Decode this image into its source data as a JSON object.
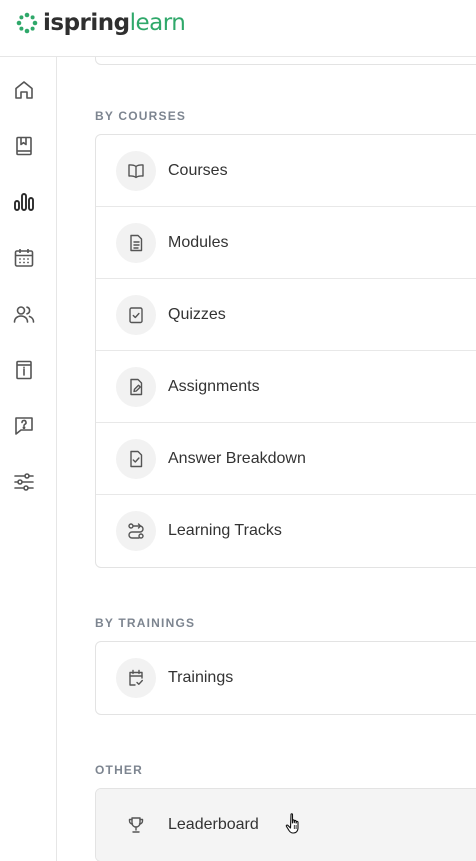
{
  "brand": {
    "name_part1": "ispring",
    "name_part2": "learn",
    "accent_color": "#2fa86a"
  },
  "sidebar": {
    "items": [
      {
        "icon": "home-icon",
        "active": false
      },
      {
        "icon": "courses-book-icon",
        "active": false
      },
      {
        "icon": "reports-chart-icon",
        "active": true
      },
      {
        "icon": "calendar-icon",
        "active": false
      },
      {
        "icon": "users-icon",
        "active": false
      },
      {
        "icon": "info-book-icon",
        "active": false
      },
      {
        "icon": "help-question-icon",
        "active": false
      },
      {
        "icon": "settings-sliders-icon",
        "active": false
      }
    ]
  },
  "sections": {
    "by_courses": {
      "title": "BY COURSES",
      "items": [
        {
          "label": "Courses",
          "icon": "open-book-icon"
        },
        {
          "label": "Modules",
          "icon": "document-icon"
        },
        {
          "label": "Quizzes",
          "icon": "quiz-check-icon"
        },
        {
          "label": "Assignments",
          "icon": "assignment-edit-icon"
        },
        {
          "label": "Answer Breakdown",
          "icon": "answer-check-icon"
        },
        {
          "label": "Learning Tracks",
          "icon": "route-icon"
        }
      ]
    },
    "by_trainings": {
      "title": "BY TRAININGS",
      "items": [
        {
          "label": "Trainings",
          "icon": "calendar-check-icon"
        }
      ]
    },
    "other": {
      "title": "OTHER",
      "items": [
        {
          "label": "Leaderboard",
          "icon": "trophy-icon",
          "hovered": true
        }
      ]
    }
  }
}
